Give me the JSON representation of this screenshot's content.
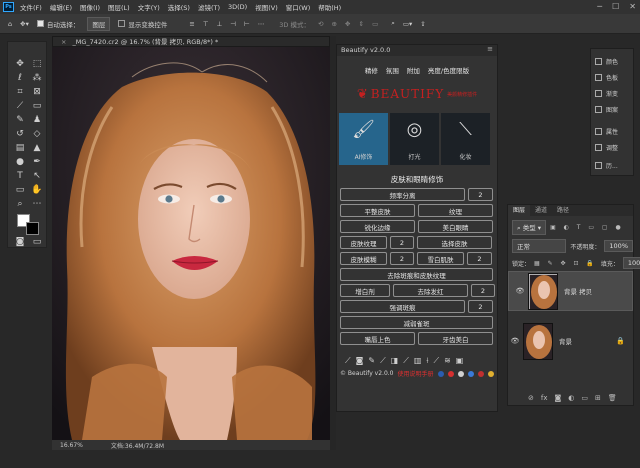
{
  "menubar": {
    "logo": "Ps",
    "items": [
      "文件(F)",
      "编辑(E)",
      "图像(I)",
      "图层(L)",
      "文字(Y)",
      "选择(S)",
      "滤镜(T)",
      "3D(D)",
      "视图(V)",
      "窗口(W)",
      "帮助(H)"
    ]
  },
  "options": {
    "auto_select_label": "自动选择：",
    "auto_select_value": "图层",
    "show_transform_label": "显示变换控件",
    "mode_3d_label": "3D 模式："
  },
  "document": {
    "tab_title": "_MG_7420.cr2 @ 16.7% (背景 拷贝, RGB/8*) *",
    "zoom": "16.67%",
    "doc_size": "文档:36.4M/72.8M"
  },
  "beautify": {
    "panel_title": "Beautify v2.0.0",
    "tabs": [
      "精修",
      "氛围",
      "附加",
      "亮度/色度限版"
    ],
    "brand_name": "BEAUTIFY",
    "brand_sub": "美颜精修插件",
    "modes": [
      {
        "label": "AI修饰",
        "icon": "brush-icon"
      },
      {
        "label": "打光",
        "icon": "light-icon"
      },
      {
        "label": "化妆",
        "icon": "makeup-brush-icon"
      }
    ],
    "section_title": "皮肤和眼睛修饰",
    "rows": [
      [
        {
          "label": "频率分离"
        },
        {
          "label": "2"
        }
      ],
      [
        {
          "label": "平整皮肤"
        },
        {
          "label": "纹理"
        }
      ],
      [
        {
          "label": "锐化边缘"
        },
        {
          "label": "美白眼睛"
        }
      ],
      [
        {
          "label": "皮肤纹理"
        },
        {
          "label": "2"
        },
        {
          "label": "选择皮肤"
        }
      ],
      [
        {
          "label": "皮肤模糊"
        },
        {
          "label": "2"
        },
        {
          "label": "雪白肌肤"
        },
        {
          "label": "2"
        }
      ],
      [
        {
          "label": "去除斑痕和皮肤纹理"
        }
      ],
      [
        {
          "label": "增白剂"
        },
        {
          "label": "去除发红"
        },
        {
          "label": "2"
        }
      ],
      [
        {
          "label": "强调斑痕"
        },
        {
          "label": "2"
        }
      ],
      [
        {
          "label": "减弱雀斑"
        }
      ],
      [
        {
          "label": "嘴唇上色"
        },
        {
          "label": "牙齿美白"
        }
      ]
    ],
    "footer_text": "© Beautify v2.0.0",
    "footer_red": "使用说明手册"
  },
  "rmini": {
    "items": [
      "颜色",
      "色板",
      "渐变",
      "图案",
      "属性",
      "调整",
      "历..."
    ]
  },
  "layers": {
    "tabs": [
      "图层",
      "通道",
      "路径"
    ],
    "kind_label": "类型",
    "blend_mode": "正常",
    "opacity_label": "不透明度：",
    "opacity_value": "100%",
    "lock_label": "锁定：",
    "fill_label": "填充：",
    "fill_value": "100%",
    "items": [
      {
        "name": "背景 拷贝",
        "selected": true
      },
      {
        "name": "背景",
        "selected": false
      }
    ]
  }
}
